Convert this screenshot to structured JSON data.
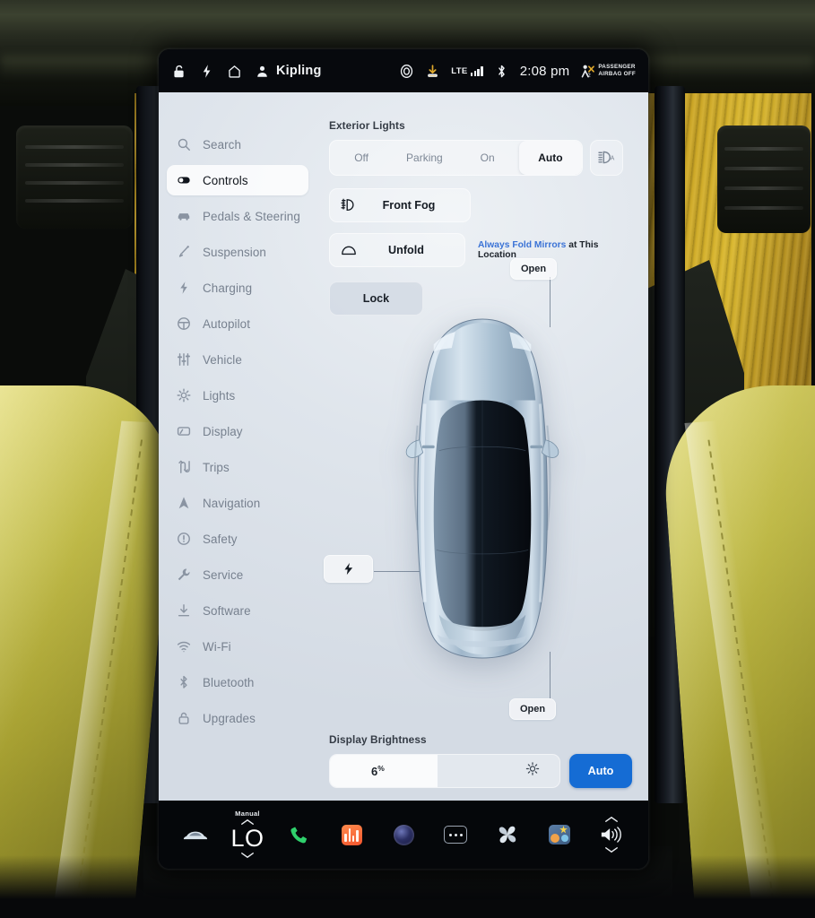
{
  "statusbar": {
    "icons_left": [
      "unlock-icon",
      "bolt-icon",
      "home-icon"
    ],
    "profile_name": "Kipling",
    "sentry_icon": "circle-target-icon",
    "download_icon": "download-arrow-icon",
    "network_label": "LTE",
    "bluetooth_icon": "bluetooth-icon",
    "time": "2:08 pm",
    "airbag_line1": "PASSENGER",
    "airbag_line2": "AIRBAG OFF"
  },
  "sidebar": {
    "items": [
      {
        "label": "Search",
        "icon": "search-icon",
        "active": false
      },
      {
        "label": "Controls",
        "icon": "toggle-icon",
        "active": true
      },
      {
        "label": "Pedals & Steering",
        "icon": "car-front-icon",
        "active": false
      },
      {
        "label": "Suspension",
        "icon": "shock-icon",
        "active": false
      },
      {
        "label": "Charging",
        "icon": "bolt-icon",
        "active": false
      },
      {
        "label": "Autopilot",
        "icon": "steering-wheel-icon",
        "active": false
      },
      {
        "label": "Vehicle",
        "icon": "sliders-icon",
        "active": false
      },
      {
        "label": "Lights",
        "icon": "sun-icon",
        "active": false
      },
      {
        "label": "Display",
        "icon": "display-icon",
        "active": false
      },
      {
        "label": "Trips",
        "icon": "trips-icon",
        "active": false
      },
      {
        "label": "Navigation",
        "icon": "navigation-arrow-icon",
        "active": false
      },
      {
        "label": "Safety",
        "icon": "alert-circle-icon",
        "active": false
      },
      {
        "label": "Service",
        "icon": "wrench-icon",
        "active": false
      },
      {
        "label": "Software",
        "icon": "download-icon",
        "active": false
      },
      {
        "label": "Wi-Fi",
        "icon": "wifi-icon",
        "active": false
      },
      {
        "label": "Bluetooth",
        "icon": "bluetooth-icon",
        "active": false
      },
      {
        "label": "Upgrades",
        "icon": "lock-icon",
        "active": false
      }
    ]
  },
  "main": {
    "exterior_lights": {
      "title": "Exterior Lights",
      "options": [
        "Off",
        "Parking",
        "On",
        "Auto"
      ],
      "selected": "Auto",
      "aux_icon": "auto-highbeam-icon"
    },
    "front_fog": {
      "label": "Front Fog",
      "icon": "fog-light-icon"
    },
    "mirrors": {
      "label": "Unfold",
      "icon": "mirror-icon",
      "note_link": "Always Fold Mirrors",
      "note_rest": " at This Location"
    },
    "lock_button": "Lock",
    "car_tags": {
      "front_trunk": "Open",
      "rear_trunk": "Open",
      "charge_port_icon": "bolt-icon"
    },
    "brightness": {
      "title": "Display Brightness",
      "value": "6",
      "unit": "%",
      "fill_percent": 47,
      "sun_icon": "sun-icon",
      "auto_label": "Auto",
      "auto_color": "#156cd4"
    }
  },
  "dock": {
    "items": [
      {
        "name": "car-icon",
        "label": ""
      },
      {
        "name": "climate-temp",
        "label": "LO",
        "sub": "Manual"
      },
      {
        "name": "phone-icon",
        "label": ""
      },
      {
        "name": "media-icon",
        "label": ""
      },
      {
        "name": "camera-icon",
        "label": ""
      },
      {
        "name": "more-dots-icon",
        "label": ""
      },
      {
        "name": "fan-icon",
        "label": ""
      },
      {
        "name": "apps-icon",
        "label": ""
      },
      {
        "name": "volume-icon",
        "label": ""
      }
    ]
  },
  "colors": {
    "accent_blue": "#156cd4",
    "link_blue": "#3b73d6",
    "panel_bg": "#dfe5ec",
    "dock_bg": "#05070a"
  }
}
